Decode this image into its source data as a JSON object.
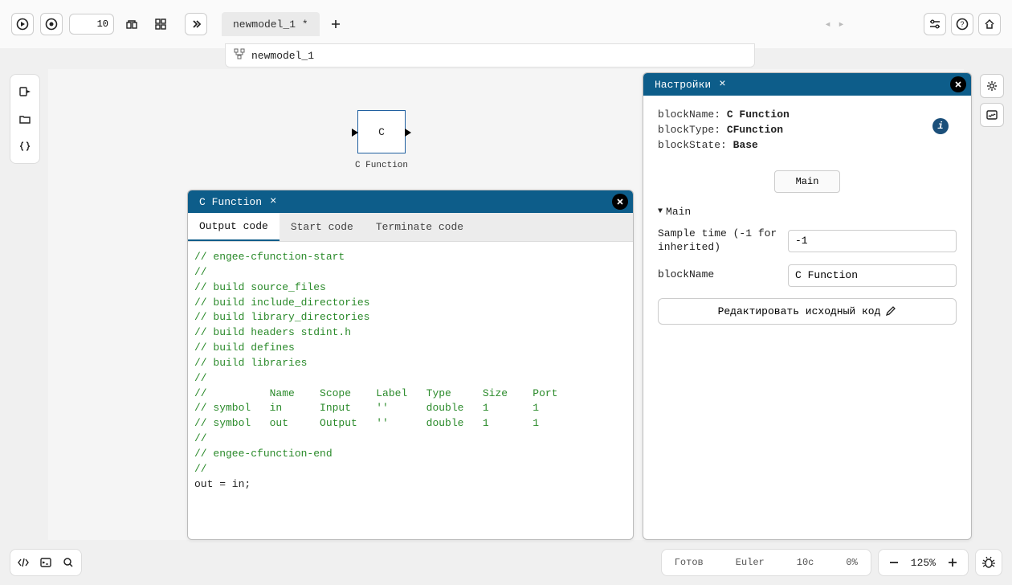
{
  "toolbar": {
    "sim_time": "10",
    "tab_label": "newmodel_1 *",
    "breadcrumb": "newmodel_1",
    "tab_arrows": "◂ ▸"
  },
  "canvas": {
    "block_letter": "C",
    "block_label": "C Function"
  },
  "code_panel": {
    "title": "C Function",
    "close_x": "×",
    "tabs": {
      "output": "Output code",
      "start": "Start code",
      "terminate": "Terminate code"
    },
    "lines": {
      "l1": "// engee-cfunction-start",
      "l2": "//",
      "l3": "// build source_files",
      "l4": "// build include_directories",
      "l5": "// build library_directories",
      "l6": "// build headers stdint.h",
      "l7": "// build defines",
      "l8": "// build libraries",
      "l9": "//",
      "l10": "//          Name    Scope    Label   Type     Size    Port",
      "l11": "// symbol   in      Input    ''      double   1       1",
      "l12": "// symbol   out     Output   ''      double   1       1",
      "l13": "//",
      "l14": "// engee-cfunction-end",
      "l15": "//",
      "stmt": "out = in;"
    }
  },
  "settings": {
    "title": "Настройки",
    "close_x": "×",
    "meta": {
      "blockName_label": "blockName:",
      "blockName_val": "C Function",
      "blockType_label": "blockType:",
      "blockType_val": "CFunction",
      "blockState_label": "blockState:",
      "blockState_val": "Base"
    },
    "mode_btn": "Main",
    "section": "Main",
    "sample_time_label": "Sample time (-1 for inherited)",
    "sample_time_val": "-1",
    "blockname_field_label": "blockName",
    "blockname_field_val": "C Function",
    "edit_btn": "Редактировать исходный код"
  },
  "status": {
    "ready": "Готов",
    "method": "Euler",
    "duration": "10с",
    "progress": "0%",
    "zoom": "125%"
  },
  "icons": {
    "info": "i"
  }
}
